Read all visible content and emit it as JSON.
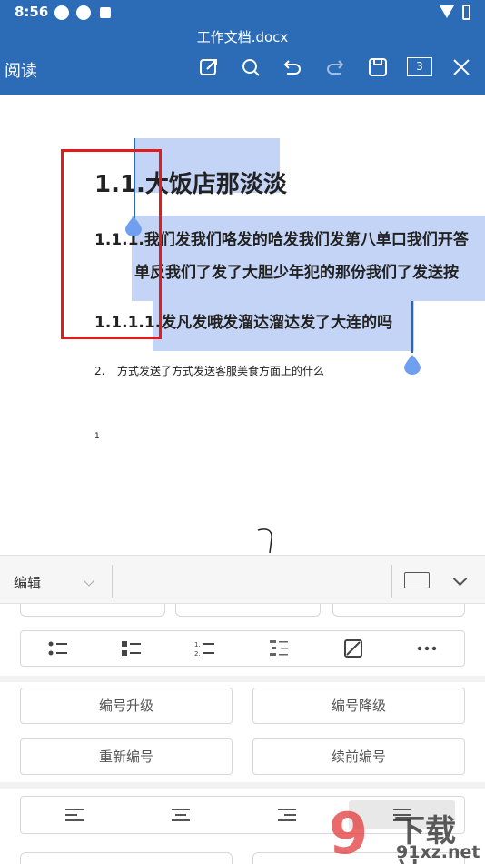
{
  "status_bar": {
    "time": "8:56"
  },
  "app_bar": {
    "document_title": "工作文档.docx",
    "read_mode_label": "阅读",
    "page_count": "3",
    "toolbar_icons": [
      "edit-icon",
      "search-icon",
      "undo-icon",
      "redo-icon",
      "save-icon",
      "page-count",
      "close-icon"
    ]
  },
  "document": {
    "heading1": "1.1.大饭店那淡淡",
    "heading2_line1": "1.1.1.我们发我们咯发的哈发我们发第八单口我们开答",
    "heading2_line2": "单反我们了发了大胆少年犯的那份我们了发送按",
    "heading3": "1.1.1.1.发凡发哦发溜达溜达发了大连的吗",
    "list_item_number": "2.",
    "list_item_text": "方式发送了方式发送客服美食方面上的什么",
    "page_number": "1"
  },
  "edit_panel": {
    "mode_label": "编辑",
    "list_icons": [
      "bullet-list-icon",
      "square-bullet-list-icon",
      "numbered-list-icon",
      "multilevel-list-icon",
      "no-list-icon",
      "more-icon"
    ],
    "buttons": {
      "promote": "编号升级",
      "demote": "编号降级",
      "restart": "重新编号",
      "continue": "续前编号"
    },
    "align_icons": [
      "align-left-icon",
      "align-center-icon",
      "align-right-icon",
      "justify-icon"
    ]
  },
  "watermark": {
    "brand": "下载站",
    "url": "91xz.net",
    "logo": "9"
  },
  "colors": {
    "accent": "#2c6cb6",
    "selection": "#c4d4f7",
    "highlight_box": "#e31b1b",
    "handle": "#6fa0f0"
  }
}
